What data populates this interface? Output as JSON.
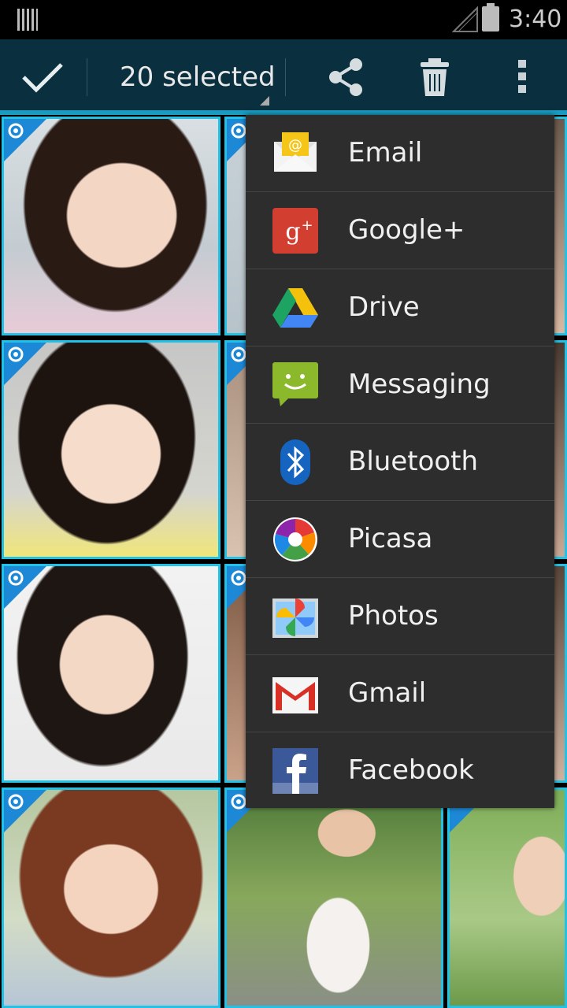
{
  "status_bar": {
    "time": "3:40"
  },
  "action_bar": {
    "selected_count_label": "20 selected",
    "done_icon": "checkmark-icon",
    "share_icon": "share-icon",
    "delete_icon": "trash-icon",
    "overflow_icon": "overflow-menu-icon"
  },
  "colors": {
    "action_bar_bg": "#0a2f3f",
    "selection_border": "#22c2e6",
    "selection_corner": "#1d88d6",
    "popup_bg": "#2d2d2d"
  },
  "share_menu": {
    "items": [
      {
        "label": "Email",
        "icon": "email-icon"
      },
      {
        "label": "Google+",
        "icon": "google-plus-icon"
      },
      {
        "label": "Drive",
        "icon": "drive-icon"
      },
      {
        "label": "Messaging",
        "icon": "messaging-icon"
      },
      {
        "label": "Bluetooth",
        "icon": "bluetooth-icon"
      },
      {
        "label": "Picasa",
        "icon": "picasa-icon"
      },
      {
        "label": "Photos",
        "icon": "photos-icon"
      },
      {
        "label": "Gmail",
        "icon": "gmail-icon"
      },
      {
        "label": "Facebook",
        "icon": "facebook-icon"
      }
    ]
  }
}
